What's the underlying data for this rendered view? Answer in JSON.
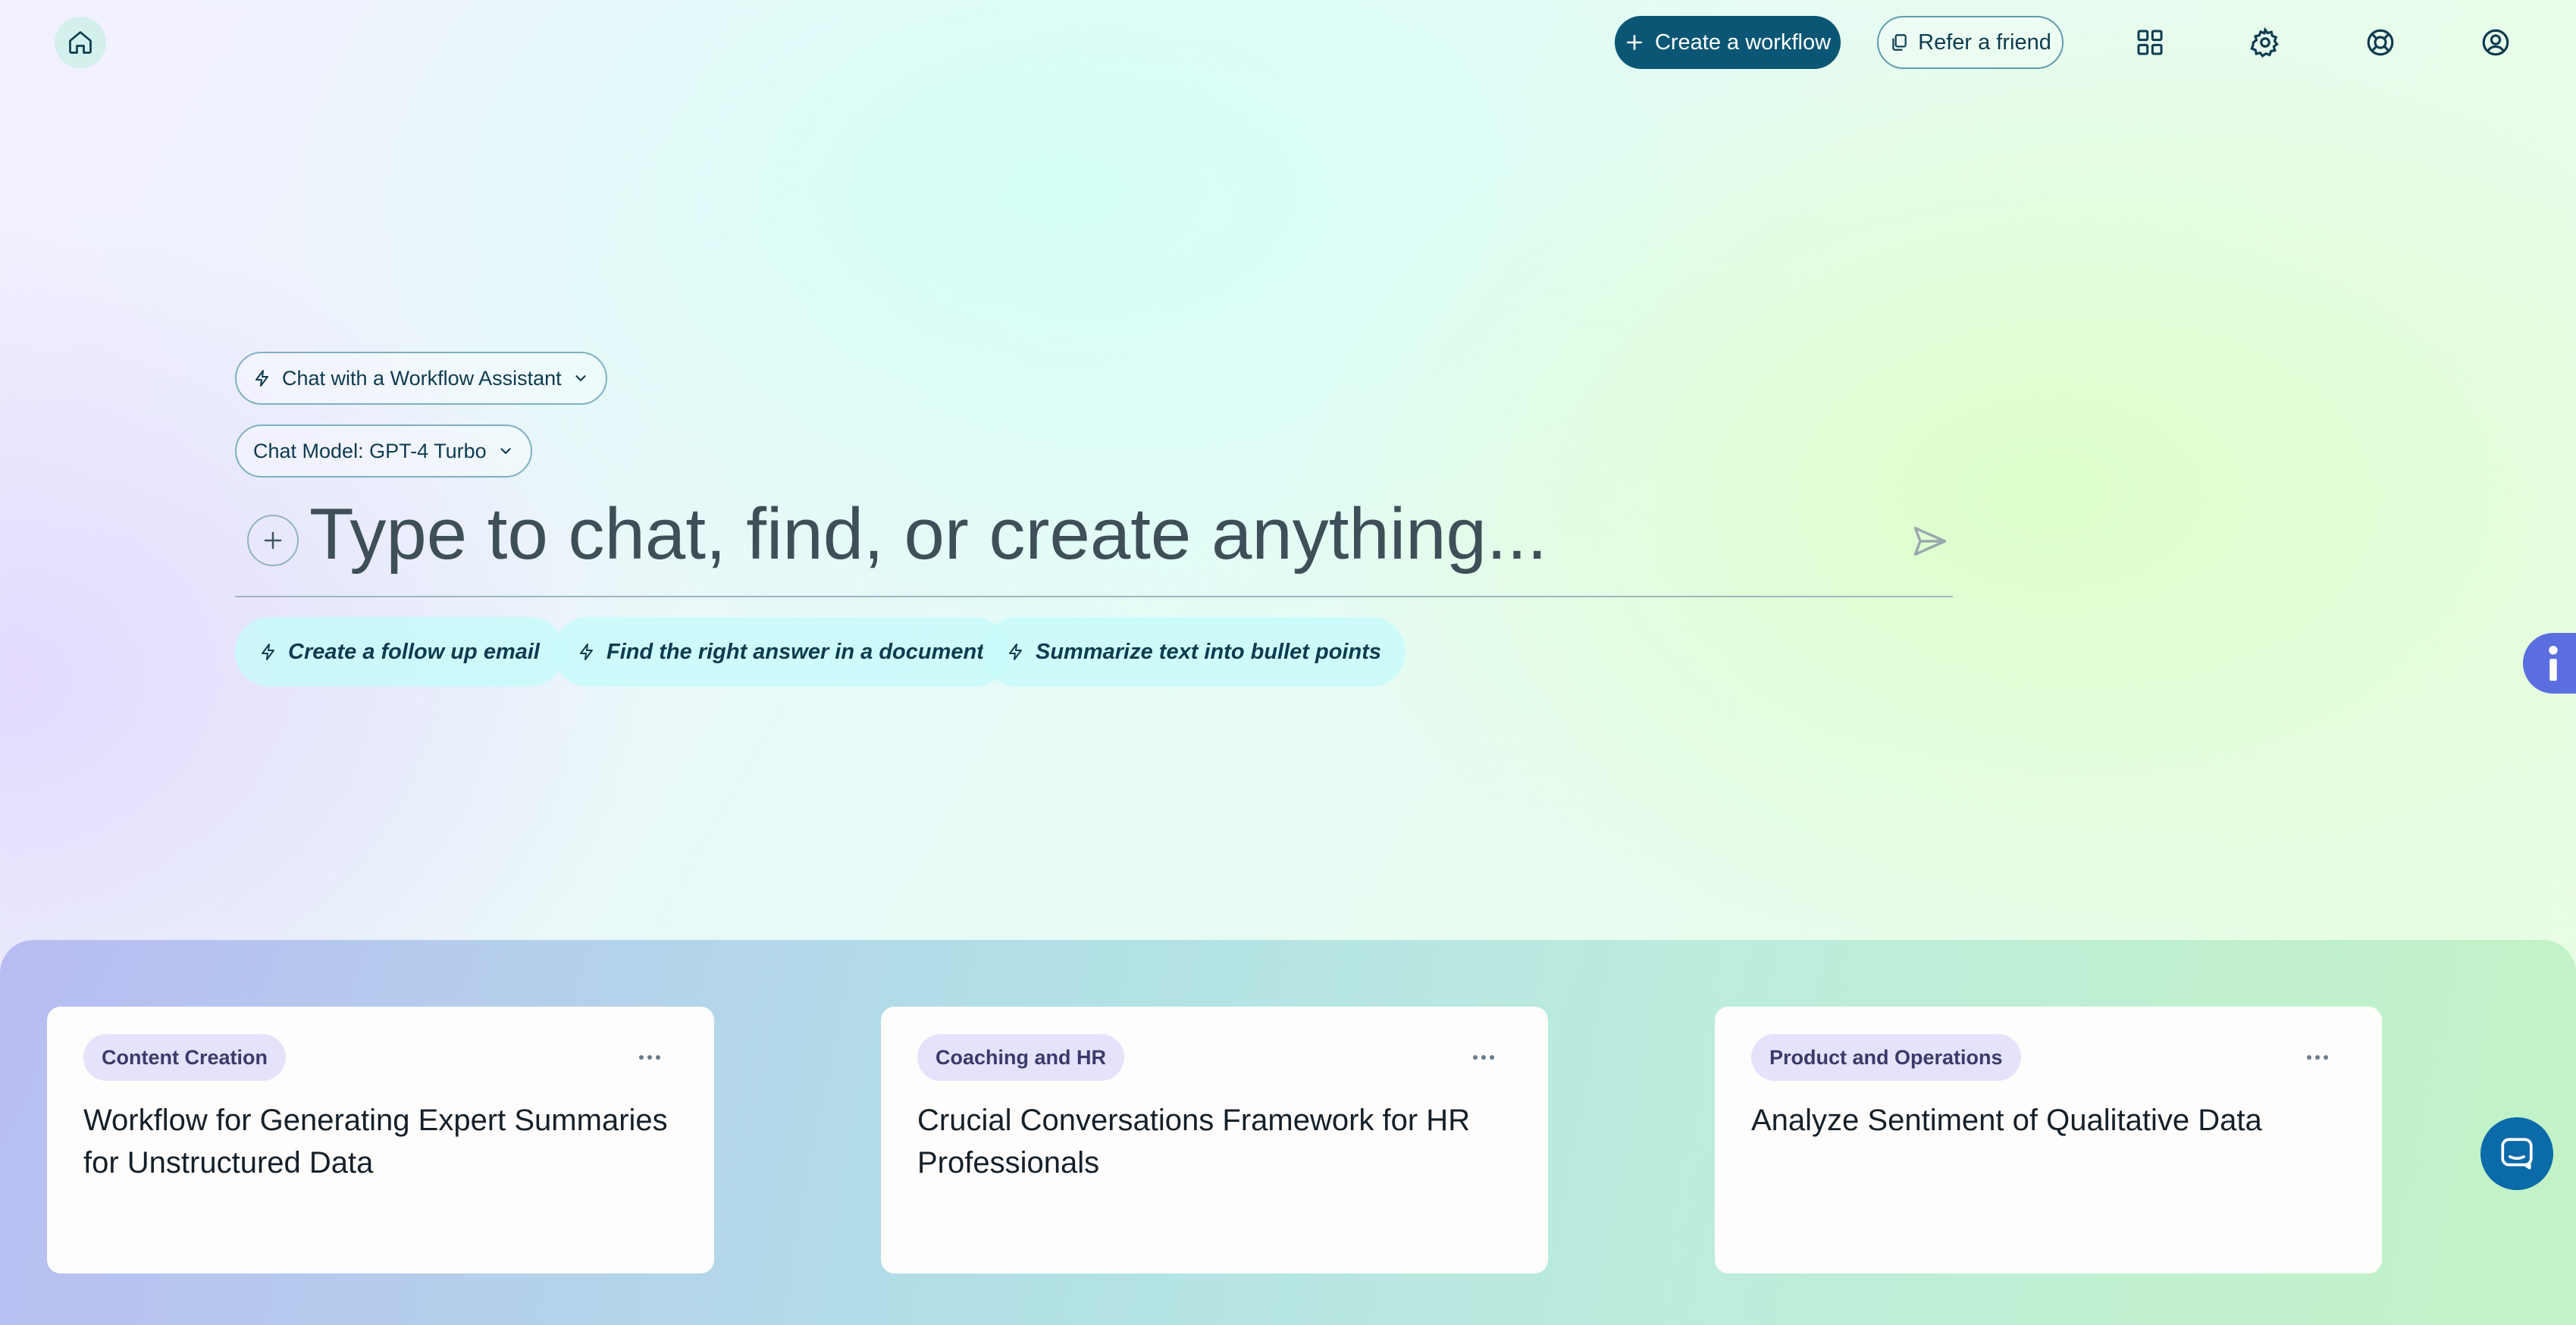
{
  "header": {
    "create_workflow_label": "Create a workflow",
    "refer_friend_label": "Refer a friend",
    "icons": [
      "home-icon",
      "plus-icon",
      "copy-icon",
      "grid-icon",
      "gear-icon",
      "help-lifebuoy-icon",
      "user-circle-icon"
    ]
  },
  "composer": {
    "assistant_selector": "Chat with a Workflow Assistant",
    "model_selector": "Chat Model: GPT-4 Turbo",
    "placeholder": "Type to chat, find, or create anything...",
    "suggestions": [
      "Create a follow up email",
      "Find the right answer in a document",
      "Summarize text into bullet points"
    ]
  },
  "cards": [
    {
      "tag": "Content Creation",
      "title": "Workflow for Generating Expert Summaries for Unstructured Data"
    },
    {
      "tag": "Coaching and HR",
      "title": "Crucial Conversations Framework for HR Professionals"
    },
    {
      "tag": "Product and Operations",
      "title": "Analyze Sentiment of Qualitative Data"
    }
  ],
  "colors": {
    "primary": "#0b5674",
    "tag_bg": "#e5e2fb",
    "info_tab": "#5a6ee0",
    "chat_bubble": "#0b6aa8"
  }
}
